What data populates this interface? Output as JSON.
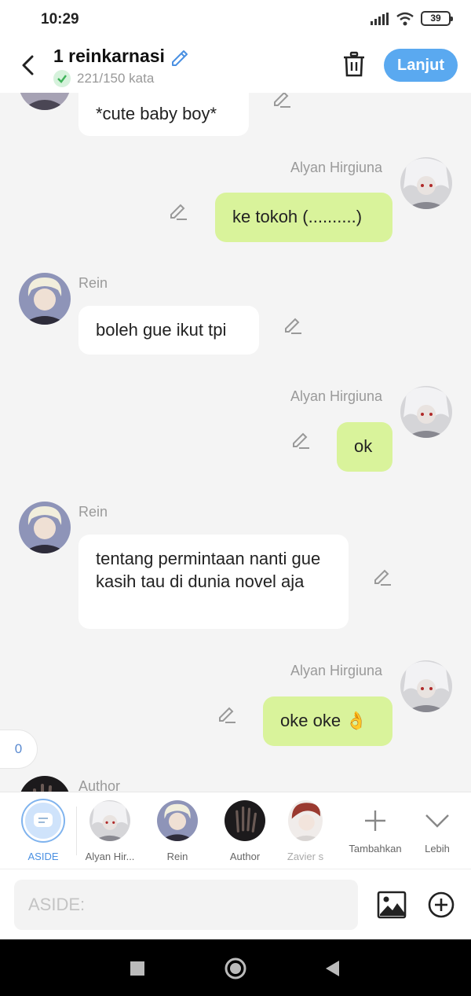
{
  "status": {
    "time": "10:29",
    "battery": "39"
  },
  "header": {
    "title": "1 reinkarnasi",
    "word_count": "221/150 kata",
    "next_button": "Lanjut"
  },
  "messages": [
    {
      "side": "left",
      "text": "*cute baby boy*"
    },
    {
      "side": "right",
      "name": "Alyan Hirgiuna",
      "text": "ke tokoh (..........)"
    },
    {
      "side": "left",
      "name": "Rein",
      "text": "boleh gue ikut tpi"
    },
    {
      "side": "right",
      "name": "Alyan Hirgiuna",
      "text": "ok"
    },
    {
      "side": "left",
      "name": "Rein",
      "text": "tentang permintaan nanti gue kasih tau di dunia novel aja"
    },
    {
      "side": "right",
      "name": "Alyan Hirgiuna",
      "text": "oke oke 👌"
    },
    {
      "side": "left",
      "name": "Author",
      "text": ""
    }
  ],
  "counter": "0",
  "characters": [
    {
      "label": "ASIDE",
      "active": true
    },
    {
      "label": "Alyan Hir..."
    },
    {
      "label": "Rein"
    },
    {
      "label": "Author"
    },
    {
      "label": "Zavier s"
    },
    {
      "label": "Tambahkan"
    },
    {
      "label": "Lebih"
    }
  ],
  "input": {
    "placeholder": "ASIDE:"
  },
  "colors": {
    "accent": "#5aa9f0",
    "right_bubble": "#d9f39b",
    "left_bubble": "#ffffff"
  }
}
